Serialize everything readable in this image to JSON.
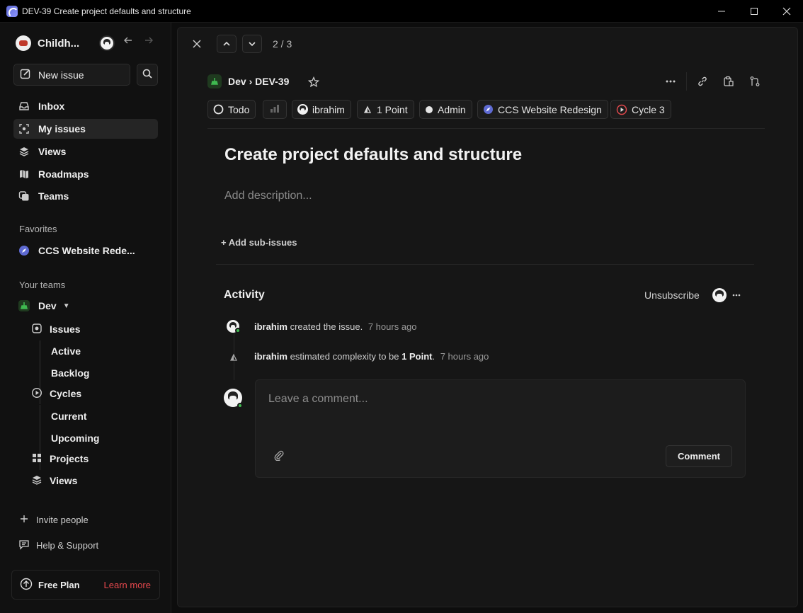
{
  "window": {
    "title": "DEV-39 Create project defaults and structure"
  },
  "sidebar": {
    "workspace_name": "Childh...",
    "new_issue_label": "New issue",
    "nav": [
      {
        "label": "Inbox",
        "icon": "inbox-icon"
      },
      {
        "label": "My issues",
        "icon": "my-issues-icon"
      },
      {
        "label": "Views",
        "icon": "layers-icon"
      },
      {
        "label": "Roadmaps",
        "icon": "map-icon"
      },
      {
        "label": "Teams",
        "icon": "teams-icon"
      }
    ],
    "favorites_label": "Favorites",
    "favorites": [
      {
        "label": "CCS Website Rede...",
        "icon": "project-compass-icon"
      }
    ],
    "your_teams_label": "Your teams",
    "team": {
      "name": "Dev",
      "issues_label": "Issues",
      "active_label": "Active",
      "backlog_label": "Backlog",
      "cycles_label": "Cycles",
      "current_label": "Current",
      "upcoming_label": "Upcoming",
      "projects_label": "Projects",
      "views_label": "Views"
    },
    "invite_label": "Invite people",
    "help_label": "Help & Support",
    "plan_label": "Free Plan",
    "learn_more_label": "Learn more"
  },
  "issue": {
    "counter": "2 / 3",
    "breadcrumb": "Dev › DEV-39",
    "properties": {
      "status": "Todo",
      "assignee": "ibrahim",
      "estimate": "1 Point",
      "label": "Admin",
      "project": "CCS Website Redesign",
      "cycle": "Cycle 3"
    },
    "title": "Create project defaults and structure",
    "description_placeholder": "Add description...",
    "add_sub_issues": "+ Add sub-issues",
    "activity_heading": "Activity",
    "unsubscribe_label": "Unsubscribe",
    "activity": [
      {
        "user": "ibrahim",
        "text": "created the issue.",
        "time": "7 hours ago"
      },
      {
        "user": "ibrahim",
        "text_before": "estimated complexity to be",
        "bold": "1 Point",
        "text_after": ".",
        "time": "7 hours ago"
      }
    ],
    "comment_placeholder": "Leave a comment...",
    "comment_button": "Comment"
  },
  "colors": {
    "accent": "#5e6ad2",
    "learn_more": "#e5484d",
    "online": "#3fb950"
  }
}
